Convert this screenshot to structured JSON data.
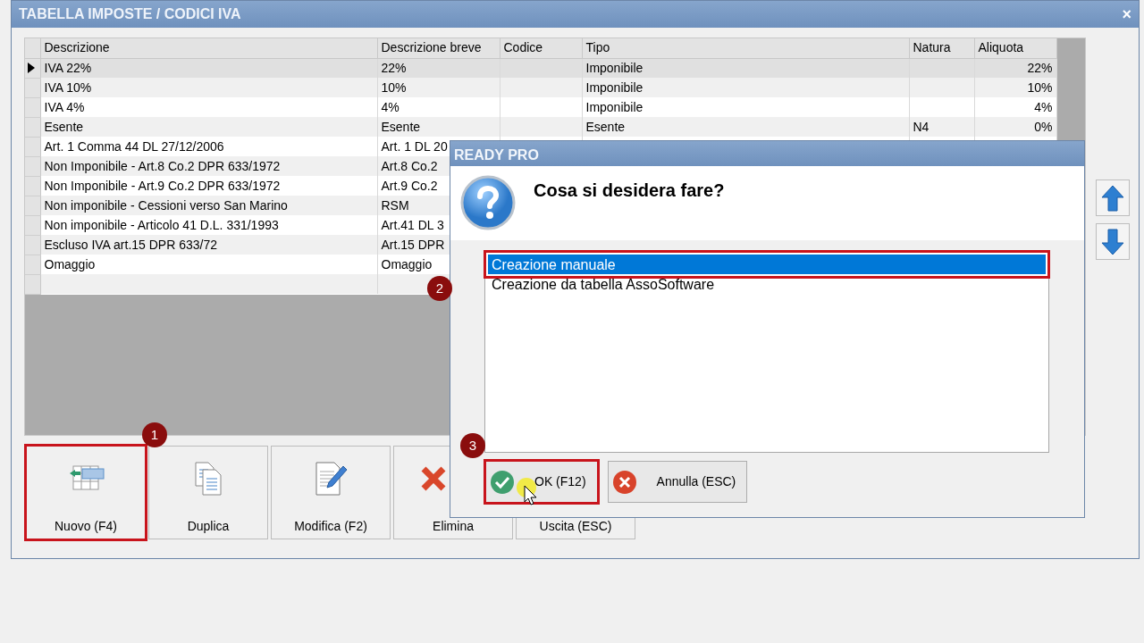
{
  "window": {
    "title": "TABELLA IMPOSTE / CODICI IVA",
    "close": "×"
  },
  "table": {
    "columns": [
      "Descrizione",
      "Descrizione breve",
      "Codice",
      "Tipo",
      "Natura",
      "Aliquota"
    ],
    "rows": [
      {
        "selected": true,
        "descrizione": "IVA 22%",
        "breve": "22%",
        "tipo": "Imponibile",
        "aliquota": "22%"
      },
      {
        "selected": false,
        "descrizione": "IVA 10%",
        "breve": "10%",
        "tipo": "Imponibile",
        "aliquota": "10%"
      },
      {
        "selected": false,
        "descrizione": "IVA 4%",
        "breve": "4%",
        "tipo": "Imponibile",
        "aliquota": "4%"
      },
      {
        "selected": false,
        "descrizione": "Esente",
        "breve": "Esente",
        "tipo": "Esente",
        "natura": "N4",
        "aliquota": "0%"
      },
      {
        "selected": false,
        "descrizione": "Art. 1 Comma 44 DL 27/12/2006",
        "breve": "Art. 1 DL 20"
      },
      {
        "selected": false,
        "descrizione": "Non Imponibile - Art.8 Co.2 DPR 633/1972",
        "breve": "Art.8 Co.2"
      },
      {
        "selected": false,
        "descrizione": "Non Imponibile - Art.9 Co.2 DPR 633/1972",
        "breve": "Art.9 Co.2"
      },
      {
        "selected": false,
        "descrizione": "Non imponibile - Cessioni verso San Marino",
        "breve": "RSM"
      },
      {
        "selected": false,
        "descrizione": "Non imponibile - Articolo 41 D.L. 331/1993",
        "breve": "Art.41 DL 3"
      },
      {
        "selected": false,
        "descrizione": "Escluso IVA art.15 DPR 633/72",
        "breve": "Art.15 DPR"
      },
      {
        "selected": false,
        "descrizione": "Omaggio",
        "breve": "Omaggio"
      }
    ]
  },
  "buttons": [
    {
      "label": "Nuovo (F4)",
      "kind": "new",
      "highlighted": true,
      "callout": "1"
    },
    {
      "label": "Duplica",
      "kind": "duplicate",
      "highlighted": false
    },
    {
      "label": "Modifica (F2)",
      "kind": "edit",
      "highlighted": false
    },
    {
      "label": "Elimina",
      "kind": "delete",
      "highlighted": false
    },
    {
      "label": "Uscita (ESC)",
      "kind": "exit",
      "highlighted": false
    }
  ],
  "dialog": {
    "title": "READY PRO",
    "question": "Cosa si desidera fare?",
    "options": [
      {
        "label": "Creazione manuale",
        "selected": true,
        "highlighted": true,
        "callout": "2"
      },
      {
        "label": "Creazione da tabella AssoSoftware",
        "selected": false,
        "highlighted": false
      }
    ],
    "buttons": [
      {
        "label": "OK (F12)",
        "kind": "ok",
        "highlighted": true,
        "callout": "3",
        "cursor": true
      },
      {
        "label": "Annulla (ESC)",
        "kind": "cancel",
        "highlighted": false
      }
    ]
  }
}
